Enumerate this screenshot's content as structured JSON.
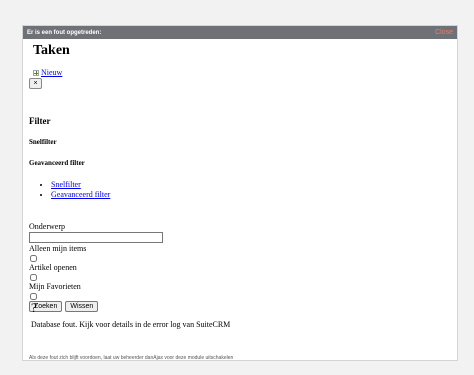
{
  "dialog": {
    "title": "Er is een fout opgetreden:",
    "close_label": "Close"
  },
  "page": {
    "title": "Taken",
    "new_label": "Nieuw",
    "dismiss_label": "×"
  },
  "filter": {
    "heading": "Filter",
    "quick_heading": "Snelfilter",
    "advanced_heading": "Geavanceerd filter",
    "tabs": [
      "Snelfilter",
      "Geavanceerd filter"
    ]
  },
  "form": {
    "subject_label": "Onderwerp",
    "subject_value": "",
    "only_mine_label": "Alleen mijn items",
    "open_item_label": "Artikel openen",
    "favorites_label": "Mijn Favorieten",
    "search_button": "Zoeken",
    "clear_button": "Wissen"
  },
  "help_symbol": "?",
  "error_message": "Database fout. Kijk voor details in de error log van SuiteCRM",
  "footer_note": "Als deze fout zich blijft voordoen, laat uw beheerder danAjax voor deze module uitschakelen"
}
